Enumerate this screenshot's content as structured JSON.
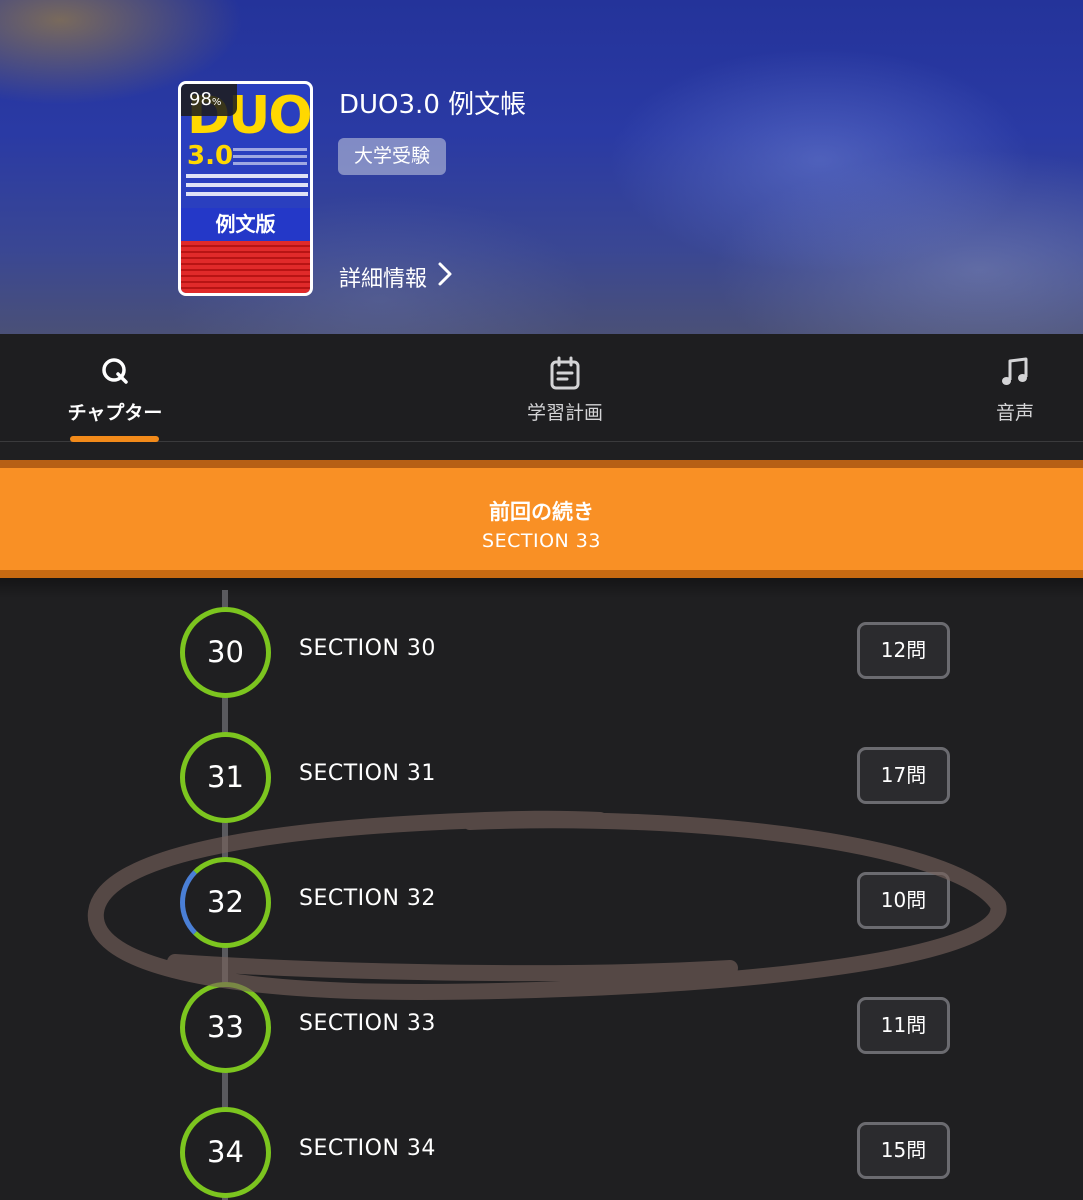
{
  "book": {
    "title": "DUO3.0 例文帳",
    "category": "大学受験",
    "detail_link": "詳細情報",
    "progress_percent": "98",
    "progress_unit": "%",
    "cover": {
      "logo": "DUO",
      "version": "3.0",
      "band": "例文版"
    }
  },
  "tabs": [
    {
      "label": "チャプター",
      "icon": "q-icon",
      "active": true
    },
    {
      "label": "学習計画",
      "icon": "calendar-icon",
      "active": false
    },
    {
      "label": "音声",
      "icon": "music-note-icon",
      "active": false
    }
  ],
  "continue_banner": {
    "title": "前回の続き",
    "subtitle": "SECTION 33"
  },
  "sections": [
    {
      "number": "30",
      "title": "SECTION 30",
      "count": "12問",
      "progress": 1.0
    },
    {
      "number": "31",
      "title": "SECTION 31",
      "count": "17問",
      "progress": 1.0
    },
    {
      "number": "32",
      "title": "SECTION 32",
      "count": "10問",
      "progress": 0.85
    },
    {
      "number": "33",
      "title": "SECTION 33",
      "count": "11問",
      "progress": 1.0
    },
    {
      "number": "34",
      "title": "SECTION 34",
      "count": "15問",
      "progress": 1.0
    }
  ],
  "colors": {
    "accent": "#f99025",
    "ring_complete": "#7cc51f",
    "ring_partial": "#4a7fd6",
    "background": "#1f1f21"
  }
}
